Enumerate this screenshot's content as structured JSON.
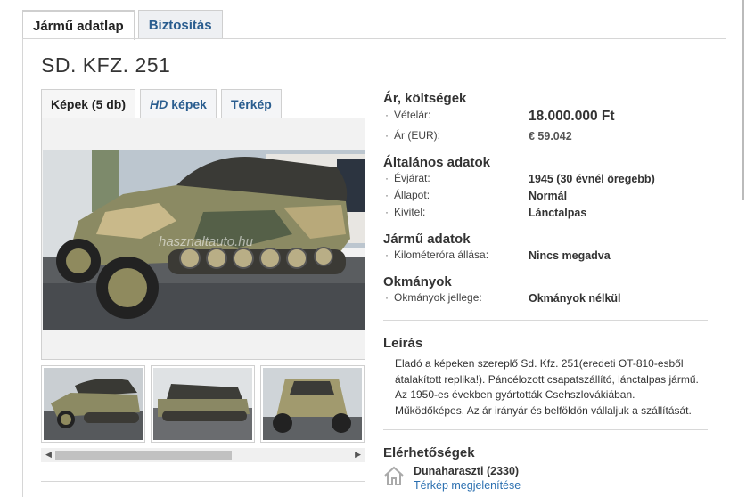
{
  "tabs": [
    {
      "label": "Jármű adatlap"
    },
    {
      "label": "Biztosítás"
    }
  ],
  "title": "SD. KFZ. 251",
  "gallery": {
    "tabs": [
      {
        "label": "Képek (5 db)"
      },
      {
        "hd": "HD",
        "label": "képek"
      },
      {
        "label": "Térkép"
      }
    ],
    "watermark": "hasznaltauto.hu"
  },
  "sections": {
    "price": {
      "title": "Ár, költségek",
      "rows": [
        {
          "label": "Vételár:",
          "value": "18.000.000 Ft"
        },
        {
          "label": "Ár (EUR):",
          "value": "€ 59.042"
        }
      ]
    },
    "general": {
      "title": "Általános adatok",
      "rows": [
        {
          "label": "Évjárat:",
          "value": "1945 (30 évnél öregebb)"
        },
        {
          "label": "Állapot:",
          "value": "Normál"
        },
        {
          "label": "Kivitel:",
          "value": "Lánctalpas"
        }
      ]
    },
    "vehicle": {
      "title": "Jármű adatok",
      "rows": [
        {
          "label": "Kilométeróra állása:",
          "value": "Nincs megadva"
        }
      ]
    },
    "docs": {
      "title": "Okmányok",
      "rows": [
        {
          "label": "Okmányok jellege:",
          "value": "Okmányok nélkül"
        }
      ]
    },
    "description": {
      "title": "Leírás",
      "text": "Eladó a képeken szereplő Sd. Kfz. 251(eredeti OT-810-esből átalakított replika!). Páncélozott csapatszállító, lánctalpas jármű. Az 1950-es években gyártották Csehszlovákiában. Működőképes. Az ár irányár és belföldön vállaljuk a szállítását."
    },
    "contact": {
      "title": "Elérhetőségek",
      "location": "Dunaharaszti (2330)",
      "map_link": "Térkép megjelenítése"
    }
  },
  "colors": {
    "link": "#2a6fb0",
    "tab_text": "#2a5d8f"
  }
}
